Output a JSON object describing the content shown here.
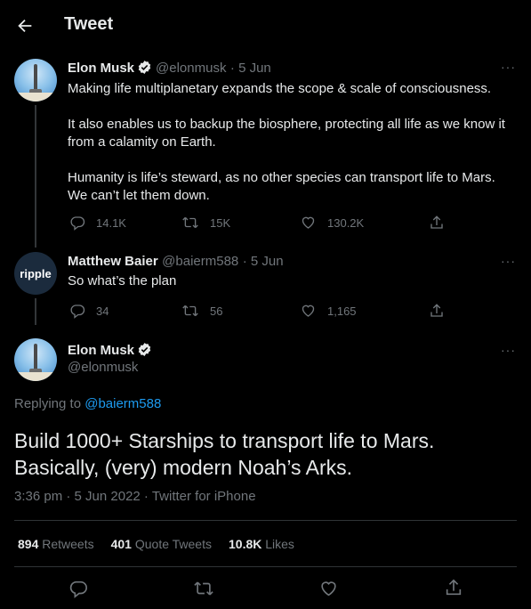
{
  "header": {
    "title": "Tweet"
  },
  "tweets": [
    {
      "name": "Elon Musk",
      "handle": "@elonmusk",
      "date": "· 5 Jun",
      "paragraphs": [
        "Making life multiplanetary expands the scope & scale of consciousness.",
        "It also enables us to backup the biosphere, protecting all life as we know it from a calamity on Earth.",
        "Humanity is life’s steward, as no other species can transport life to Mars. We can’t let them down."
      ],
      "replies": "14.1K",
      "retweets": "15K",
      "likes": "130.2K"
    },
    {
      "name": "Matthew Baier",
      "handle": "@baierm588",
      "date": "· 5 Jun",
      "avatar_text": "ripple",
      "text": "So what’s the plan",
      "replies": "34",
      "retweets": "56",
      "likes": "1,165"
    }
  ],
  "main_tweet": {
    "name": "Elon Musk",
    "handle": "@elonmusk",
    "replying_prefix": "Replying to",
    "replying_to": "@baierm588",
    "text": "Build 1000+ Starships to transport life to Mars. Basically, (very) modern Noah’s Arks.",
    "timestamp": "3:36 pm · 5 Jun 2022 · Twitter for iPhone",
    "stats": {
      "retweets": "894",
      "retweets_label": "Retweets",
      "quotes": "401",
      "quotes_label": "Quote Tweets",
      "likes": "10.8K",
      "likes_label": "Likes"
    }
  },
  "more_label": "···",
  "colors": {
    "link": "#1d9bf0",
    "verified": "#ffffff",
    "background": "#000000"
  }
}
